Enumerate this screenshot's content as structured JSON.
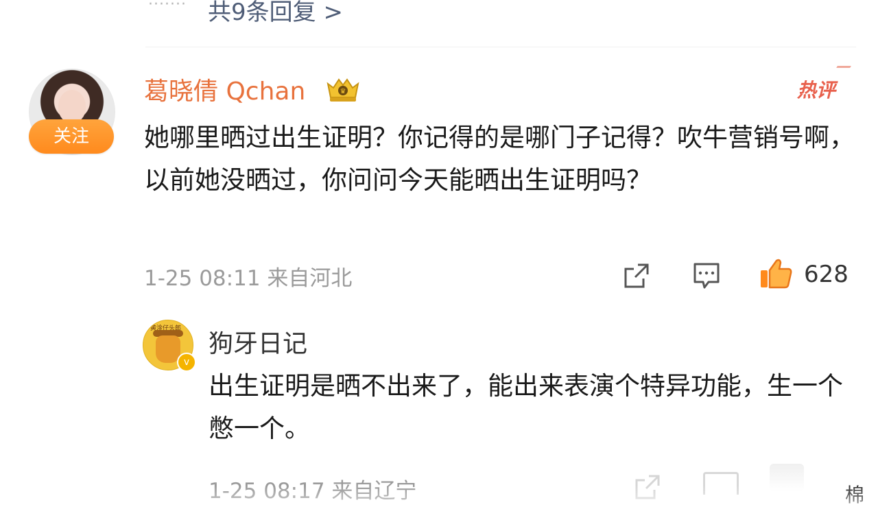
{
  "replies_link": {
    "dots": "·······",
    "label": "共9条回复 >"
  },
  "comment": {
    "username": "葛晓倩 Qchan",
    "follow_label": "关注",
    "hot_badge": "热评",
    "text": "她哪里晒过出生证明？你记得的是哪门子记得？吹牛营销号啊，以前她没晒过，你问问今天能晒出生证明吗？",
    "meta": "1-25 08:11 来自河北",
    "like_count": "628",
    "icons": {
      "vip": "vip-crown-icon",
      "share": "share-icon",
      "comment": "comment-icon",
      "like": "thumbs-up-icon"
    },
    "colors": {
      "username": "#e8723d",
      "follow_button": "#ff9a2e",
      "hot_badge": "#e8604c",
      "like_icon": "#ff8a1d"
    }
  },
  "reply": {
    "username": "狗牙日记",
    "text": "出生证明是晒不出来了，能出来表演个特异功能，生一个憋一个。",
    "meta": "1-25 08:17 来自辽宁",
    "verify_badge": "v"
  },
  "watermark": "棉"
}
